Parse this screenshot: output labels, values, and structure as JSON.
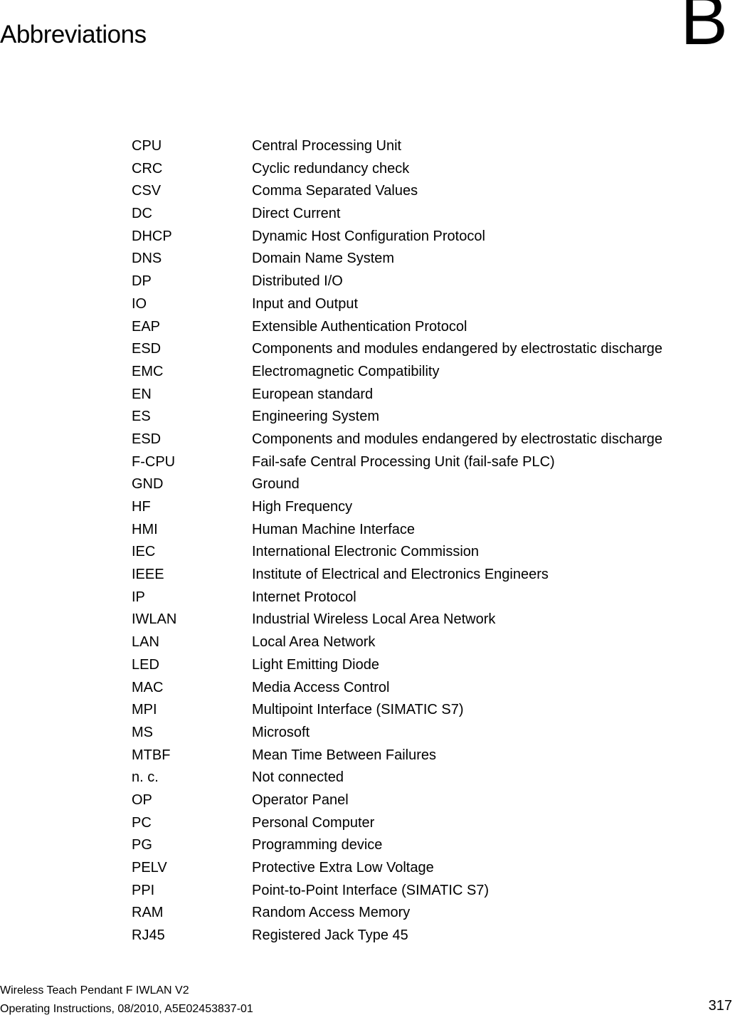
{
  "header": {
    "title": "Abbreviations",
    "chapter_letter": "B"
  },
  "abbreviations": [
    {
      "term": "CPU",
      "definition": "Central Processing Unit"
    },
    {
      "term": "CRC",
      "definition": "Cyclic redundancy check"
    },
    {
      "term": "CSV",
      "definition": "Comma Separated Values"
    },
    {
      "term": "DC",
      "definition": "Direct Current"
    },
    {
      "term": "DHCP",
      "definition": "Dynamic Host Configuration Protocol"
    },
    {
      "term": "DNS",
      "definition": "Domain Name System"
    },
    {
      "term": "DP",
      "definition": "Distributed I/O"
    },
    {
      "term": "IO",
      "definition": "Input and Output"
    },
    {
      "term": "EAP",
      "definition": "Extensible Authentication Protocol"
    },
    {
      "term": "ESD",
      "definition": "Components and modules endangered by electrostatic discharge"
    },
    {
      "term": "EMC",
      "definition": "Electromagnetic Compatibility"
    },
    {
      "term": "EN",
      "definition": "European standard"
    },
    {
      "term": "ES",
      "definition": "Engineering System"
    },
    {
      "term": "ESD",
      "definition": "Components and modules endangered by electrostatic discharge"
    },
    {
      "term": "F-CPU",
      "definition": "Fail-safe Central Processing Unit (fail-safe PLC)"
    },
    {
      "term": "GND",
      "definition": "Ground"
    },
    {
      "term": "HF",
      "definition": "High Frequency"
    },
    {
      "term": "HMI",
      "definition": "Human Machine Interface"
    },
    {
      "term": "IEC",
      "definition": "International Electronic Commission"
    },
    {
      "term": "IEEE",
      "definition": "Institute of Electrical and Electronics Engineers"
    },
    {
      "term": "IP",
      "definition": "Internet Protocol"
    },
    {
      "term": "IWLAN",
      "definition": "Industrial Wireless Local Area Network"
    },
    {
      "term": "LAN",
      "definition": "Local Area Network"
    },
    {
      "term": "LED",
      "definition": "Light Emitting Diode"
    },
    {
      "term": "MAC",
      "definition": "Media Access Control"
    },
    {
      "term": "MPI",
      "definition": "Multipoint Interface (SIMATIC S7)"
    },
    {
      "term": "MS",
      "definition": "Microsoft"
    },
    {
      "term": "MTBF",
      "definition": "Mean Time Between Failures"
    },
    {
      "term": "n. c.",
      "definition": "Not connected"
    },
    {
      "term": "OP",
      "definition": "Operator Panel"
    },
    {
      "term": "PC",
      "definition": "Personal Computer"
    },
    {
      "term": "PG",
      "definition": "Programming device"
    },
    {
      "term": "PELV",
      "definition": "Protective Extra Low Voltage"
    },
    {
      "term": "PPI",
      "definition": "Point-to-Point Interface (SIMATIC S7)"
    },
    {
      "term": "RAM",
      "definition": "Random Access Memory"
    },
    {
      "term": "RJ45",
      "definition": "Registered Jack Type 45"
    }
  ],
  "footer": {
    "product": "Wireless Teach Pendant F IWLAN V2",
    "document_info": "Operating Instructions, 08/2010, A5E02453837-01",
    "page_number": "317"
  }
}
